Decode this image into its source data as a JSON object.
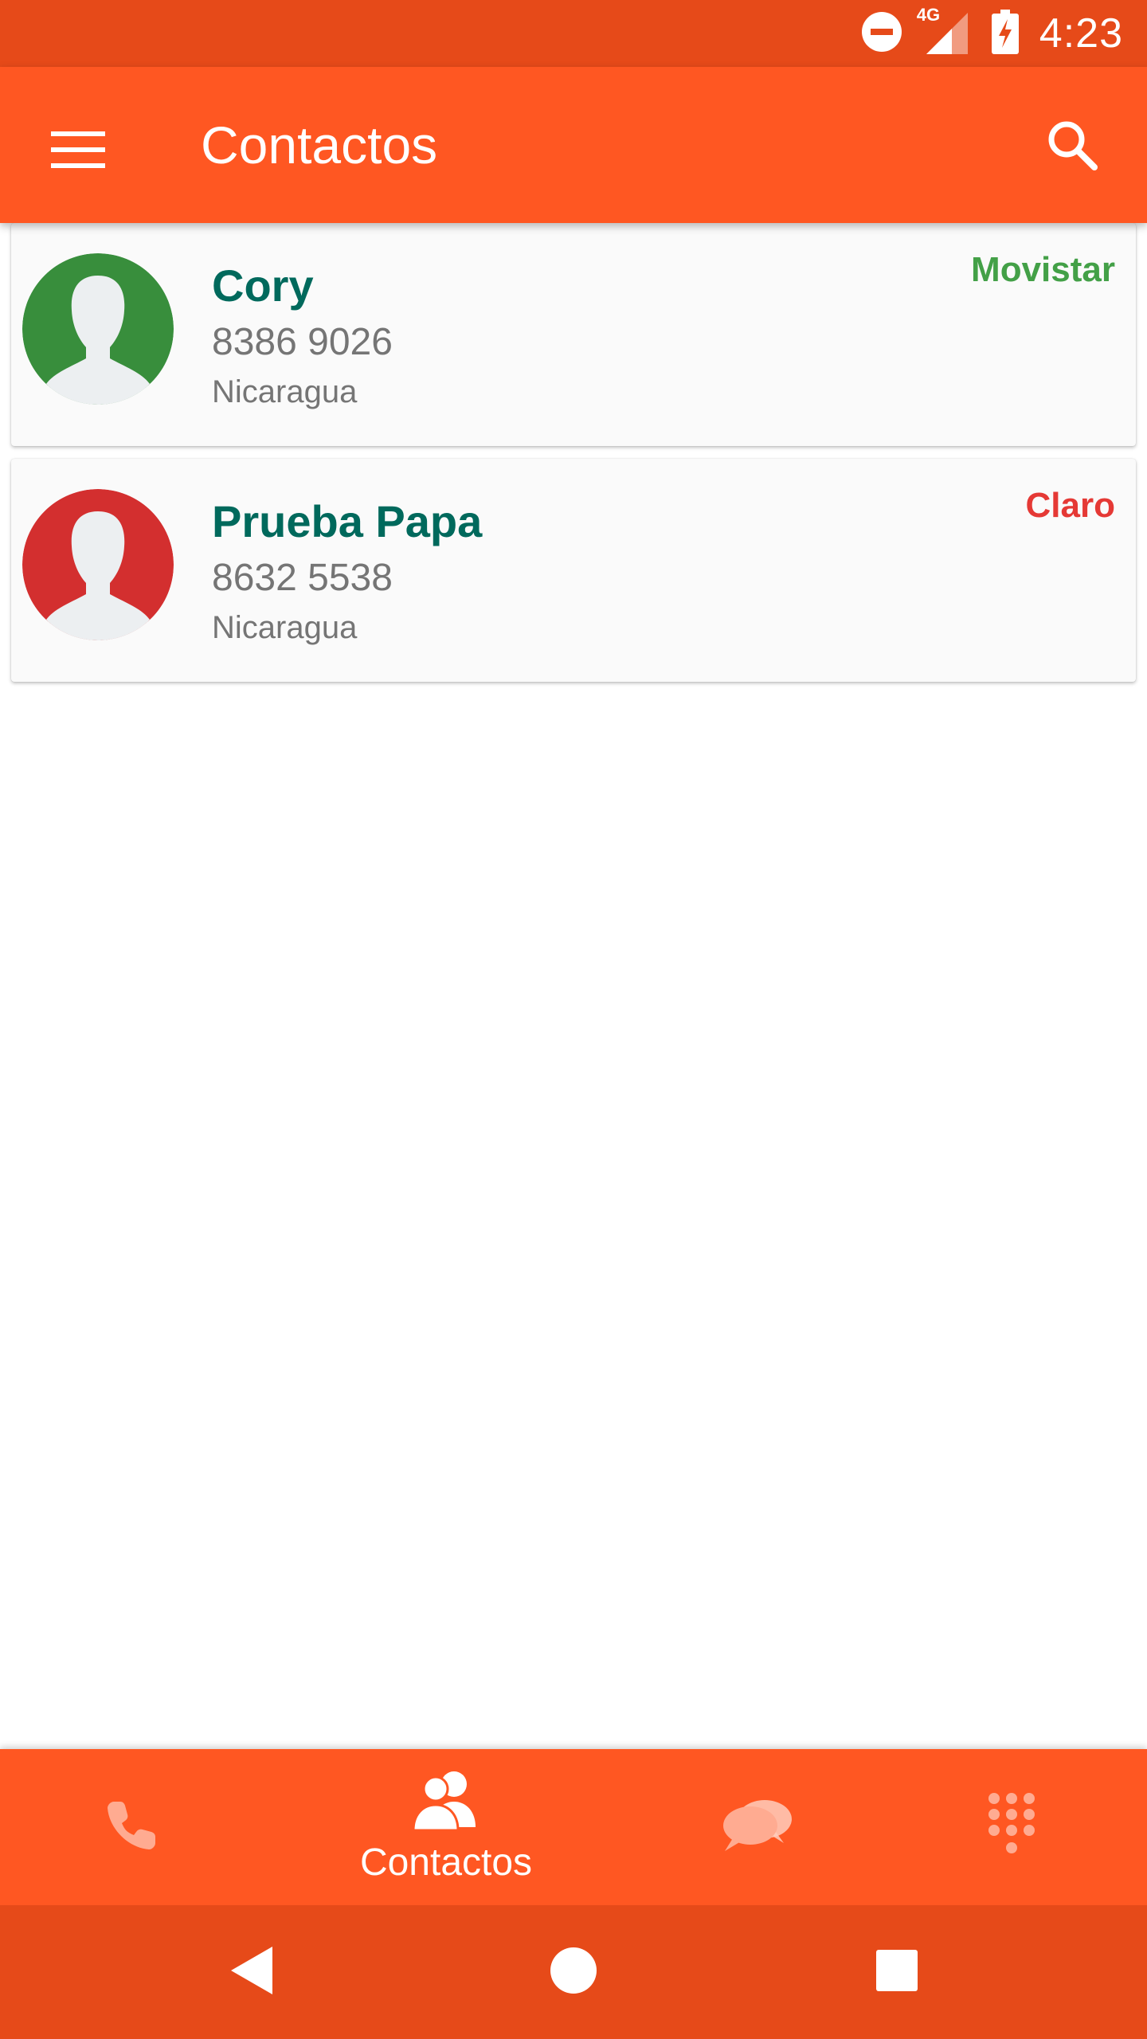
{
  "status_bar": {
    "time": "4:23",
    "network_label": "4G",
    "icons": [
      "do-not-disturb-icon",
      "signal-4g-icon",
      "battery-charging-icon"
    ]
  },
  "app_bar": {
    "title": "Contactos",
    "menu_icon": "hamburger-menu-icon",
    "search_icon": "search-icon"
  },
  "contacts": [
    {
      "name": "Cory",
      "phone": "8386 9026",
      "country": "Nicaragua",
      "carrier": "Movistar",
      "carrier_color": "#43A047",
      "avatar_color": "#388E3C"
    },
    {
      "name": "Prueba Papa",
      "phone": "8632 5538",
      "country": "Nicaragua",
      "carrier": "Claro",
      "carrier_color": "#E53935",
      "avatar_color": "#D32F2F"
    }
  ],
  "bottom_nav": {
    "items": [
      {
        "icon": "phone-icon",
        "label": ""
      },
      {
        "icon": "contacts-icon",
        "label": "Contactos",
        "active": true
      },
      {
        "icon": "chat-icon",
        "label": ""
      },
      {
        "icon": "dialpad-icon",
        "label": ""
      }
    ]
  },
  "system_nav": {
    "icons": [
      "back-icon",
      "home-icon",
      "recents-icon"
    ]
  },
  "colors": {
    "primary": "#FF5722",
    "primary_dark": "#E64A19",
    "name_text": "#00695C",
    "secondary_text": "#757575"
  }
}
